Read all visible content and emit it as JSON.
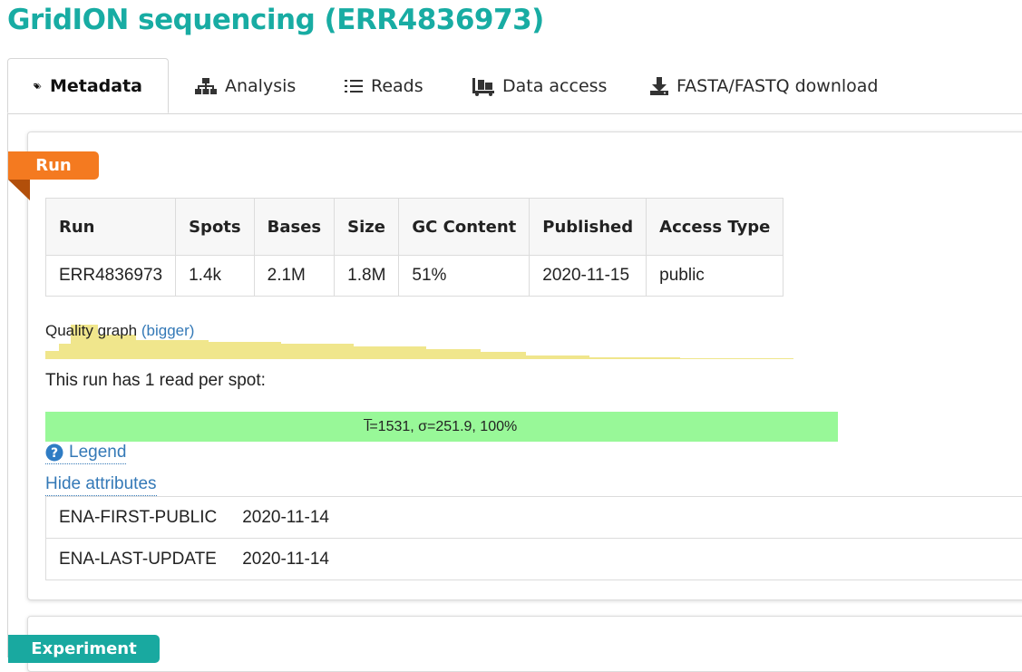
{
  "page": {
    "title": "GridION sequencing (ERR4836973)"
  },
  "tabs": [
    {
      "label": "Metadata",
      "icon": "tags-icon",
      "active": true
    },
    {
      "label": "Analysis",
      "icon": "sitemap-icon"
    },
    {
      "label": "Reads",
      "icon": "list-icon"
    },
    {
      "label": "Data access",
      "icon": "dolly-icon"
    },
    {
      "label": "FASTA/FASTQ download",
      "icon": "download-icon"
    }
  ],
  "run_section": {
    "ribbon": "Run",
    "headers": [
      "Run",
      "Spots",
      "Bases",
      "Size",
      "GC Content",
      "Published",
      "Access Type"
    ],
    "row": [
      "ERR4836973",
      "1.4k",
      "2.1M",
      "1.8M",
      "51%",
      "2020-11-15",
      "public"
    ]
  },
  "quality": {
    "label": "Quality graph",
    "link": "(bigger)",
    "color": "#f0e68c"
  },
  "reads": {
    "per_spot_text": "This run has 1 read per spot:",
    "bar_text": "l̅=1531, σ=251.9, 100%",
    "bar_color": "#98f898"
  },
  "legend_label": "Legend",
  "hide_attributes_label": "Hide attributes",
  "attributes": [
    {
      "key": "ENA-FIRST-PUBLIC",
      "value": "2020-11-14"
    },
    {
      "key": "ENA-LAST-UPDATE",
      "value": "2020-11-14"
    }
  ],
  "experiment_section": {
    "ribbon": "Experiment"
  },
  "colors": {
    "accent": "#18aca3",
    "run_ribbon": "#f47a20",
    "link": "#3479b7"
  }
}
